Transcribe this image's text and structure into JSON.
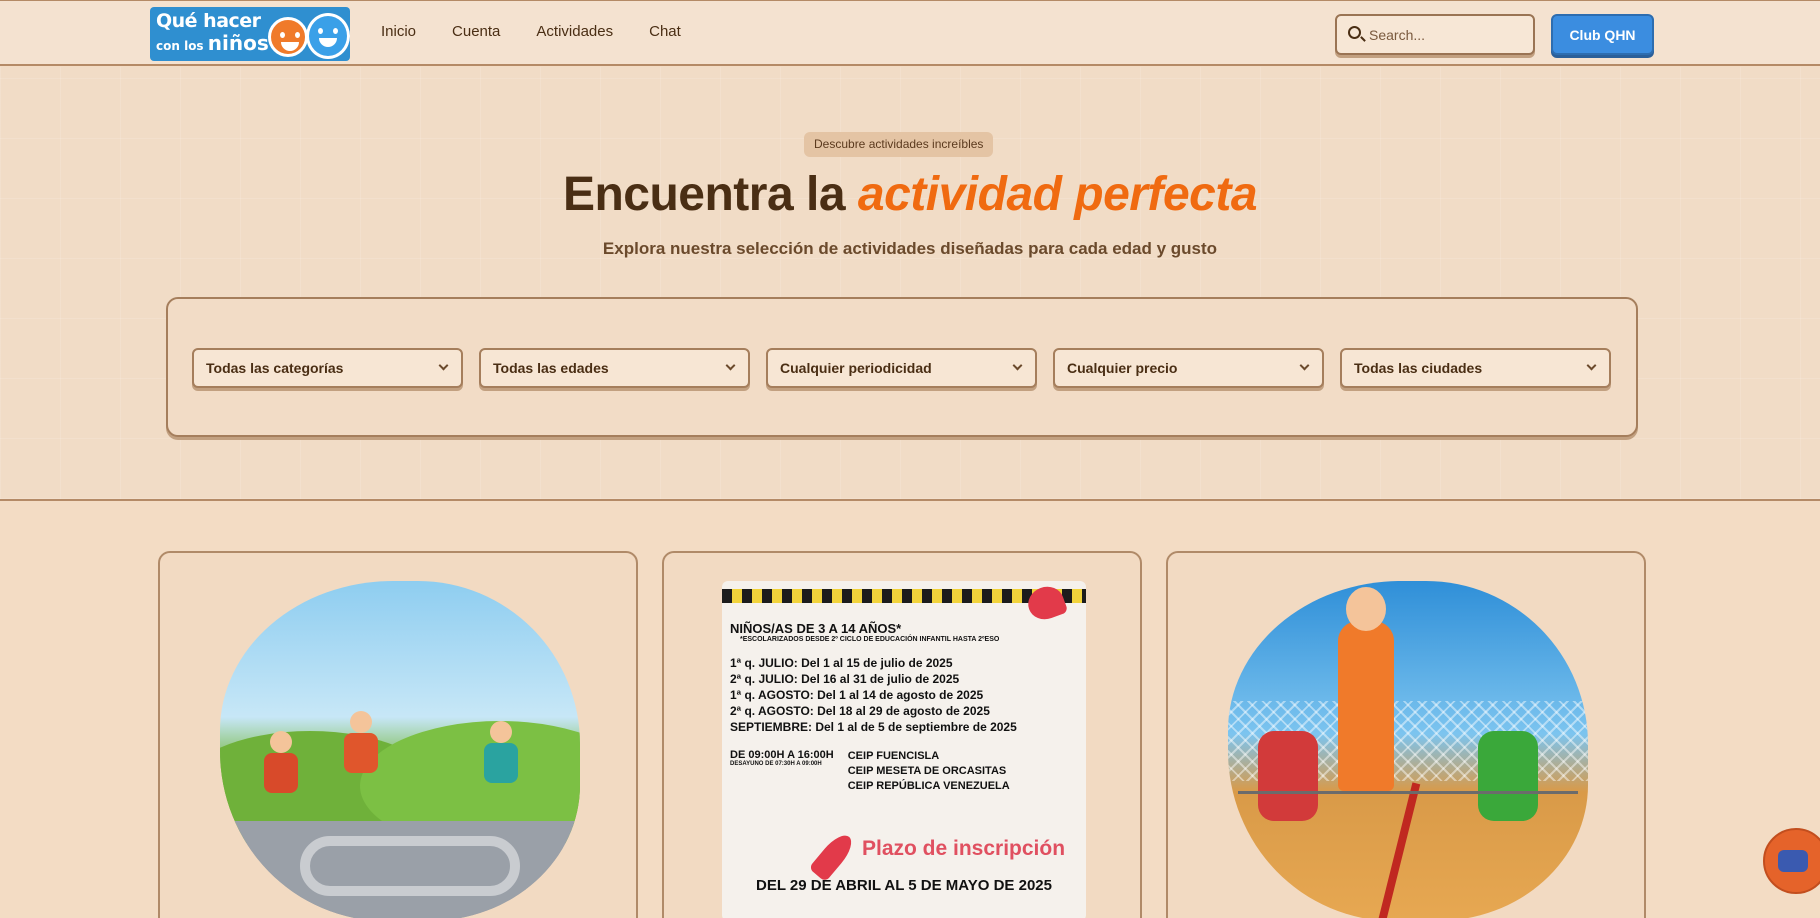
{
  "logo": {
    "line1": "Qué hacer",
    "line2_prefix": "con los",
    "line2_word": "niños"
  },
  "nav": {
    "items": [
      {
        "label": "Inicio"
      },
      {
        "label": "Cuenta"
      },
      {
        "label": "Actividades"
      },
      {
        "label": "Chat"
      }
    ]
  },
  "search": {
    "placeholder": "Search...",
    "value": ""
  },
  "header": {
    "club_button": "Club QHN"
  },
  "hero": {
    "badge": "Descubre actividades increíbles",
    "title_plain": "Encuentra la",
    "title_highlight": "actividad perfecta",
    "subtitle": "Explora nuestra selección de actividades diseñadas para cada edad y gusto"
  },
  "filters": [
    {
      "selected": "Todas las categorías"
    },
    {
      "selected": "Todas las edades"
    },
    {
      "selected": "Cualquier periodicidad"
    },
    {
      "selected": "Cualquier precio"
    },
    {
      "selected": "Todas las ciudades"
    }
  ],
  "poster": {
    "heading": "NIÑOS/AS DE 3 A 14 AÑOS*",
    "note": "*ESCOLARIZADOS DESDE 2º CICLO DE EDUCACIÓN INFANTIL HASTA 2ºESO",
    "periods": [
      "1ª q. JULIO: Del 1 al 15 de julio de 2025",
      "2ª q. JULIO: Del 16 al 31 de julio de 2025",
      "1ª q. AGOSTO: Del 1 al 14 de agosto de 2025",
      "2ª q. AGOSTO: Del 18 al 29 de agosto de 2025",
      "SEPTIEMBRE: Del 1 al de 5 de septiembre de 2025"
    ],
    "schedule": "DE 09:00H A 16:00H",
    "schedule_note": "DESAYUNO DE 07:30H A 09:00H",
    "schools": [
      "CEIP FUENCISLA",
      "CEIP MESETA DE ORCASITAS",
      "CEIP REPÚBLICA VENEZUELA"
    ],
    "deadline_label": "Plazo de inscripción",
    "deadline_dates": "DEL 29 DE ABRIL AL 5 DE MAYO DE 2025"
  },
  "colors": {
    "accent_orange": "#f06a10",
    "primary_blue": "#3b8de0",
    "background": "#f3dcc4",
    "text_brown": "#4a2e14"
  },
  "icons": {
    "search": "search-icon",
    "chevron": "chevron-down-icon",
    "float": "chat-help-icon"
  }
}
